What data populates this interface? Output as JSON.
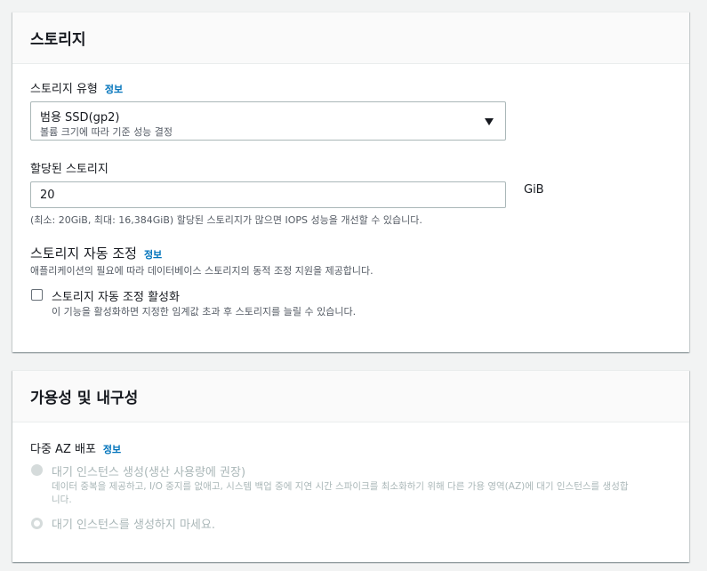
{
  "storage": {
    "title": "스토리지",
    "info_label": "정보",
    "storage_type": {
      "label": "스토리지 유형",
      "selected": "범용 SSD(gp2)",
      "selected_description": "볼륨 크기에 따라 기준 성능 결정"
    },
    "allocated": {
      "label": "할당된 스토리지",
      "value": "20",
      "unit": "GiB",
      "hint": "(최소: 20GiB, 최대: 16,384GiB) 할당된 스토리지가 많으면 IOPS 성능을 개선할 수 있습니다."
    },
    "autoscaling": {
      "title": "스토리지 자동 조정",
      "description": "애플리케이션의 필요에 따라 데이터베이스 스토리지의 동적 조정 지원을 제공합니다.",
      "checkbox_label": "스토리지 자동 조정 활성화",
      "checkbox_checked": false,
      "checkbox_description": "이 기능을 활성화하면 지정한 임계값 초과 후 스토리지를 늘릴 수 있습니다."
    }
  },
  "availability": {
    "title": "가용성 및 내구성",
    "multi_az": {
      "label": "다중 AZ 배포",
      "info_label": "정보",
      "options": [
        {
          "label": "대기 인스턴스 생성(생산 사용량에 권장)",
          "description_line1": "데이터 중복을 제공하고, I/O 중지를 없애고, 시스템 백업 중에 지연 시간 스파이크를 최소화하기 위해 다른 가용 영역(AZ)에 대기 인스턴스를 생성합",
          "description_line2": "니다.",
          "selected": false
        },
        {
          "label": "대기 인스턴스를 생성하지 마세요.",
          "selected": true
        }
      ]
    }
  },
  "colors": {
    "link": "#0073bb",
    "disabled_text": "#aab7b8",
    "page_background": "#f2f3f3"
  }
}
